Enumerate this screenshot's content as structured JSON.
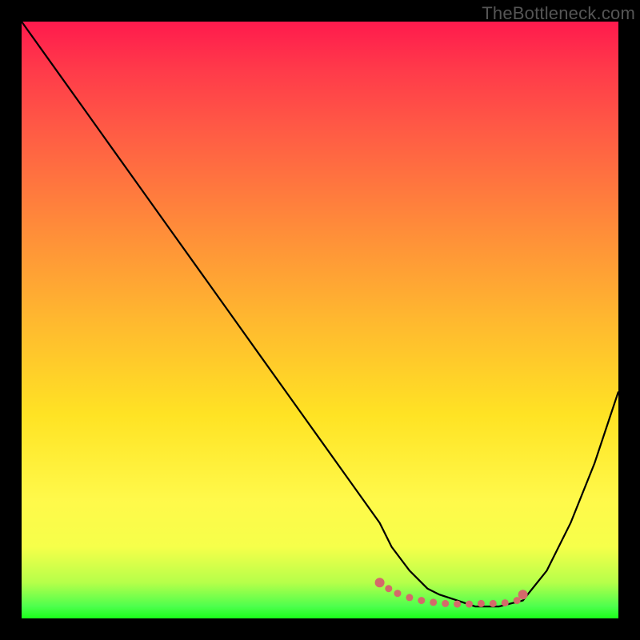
{
  "watermark": "TheBottleneck.com",
  "chart_data": {
    "type": "line",
    "title": "",
    "xlabel": "",
    "ylabel": "",
    "xlim": [
      0,
      100
    ],
    "ylim": [
      0,
      100
    ],
    "grid": false,
    "legend": false,
    "series": [
      {
        "name": "bottleneck-curve",
        "color": "#000000",
        "x": [
          0,
          5,
          10,
          15,
          20,
          25,
          30,
          35,
          40,
          45,
          50,
          55,
          60,
          62,
          65,
          68,
          70,
          73,
          76,
          80,
          84,
          88,
          92,
          96,
          100
        ],
        "y": [
          100,
          93,
          86,
          79,
          72,
          65,
          58,
          51,
          44,
          37,
          30,
          23,
          16,
          12,
          8,
          5,
          4,
          3,
          2,
          2,
          3,
          8,
          16,
          26,
          38
        ]
      }
    ],
    "highlight_points": {
      "name": "good-fit-zone",
      "color": "#d46a6a",
      "x": [
        60,
        61.5,
        63,
        65,
        67,
        69,
        71,
        73,
        75,
        77,
        79,
        81,
        83,
        84
      ],
      "y": [
        6.0,
        5.0,
        4.2,
        3.5,
        3.0,
        2.7,
        2.5,
        2.4,
        2.4,
        2.5,
        2.5,
        2.6,
        3.0,
        4.0
      ]
    },
    "gradient_stops": [
      {
        "pos": 0.0,
        "color": "#ff1a4d"
      },
      {
        "pos": 0.5,
        "color": "#ffb82f"
      },
      {
        "pos": 0.85,
        "color": "#fff94a"
      },
      {
        "pos": 1.0,
        "color": "#1aff1a"
      }
    ]
  }
}
